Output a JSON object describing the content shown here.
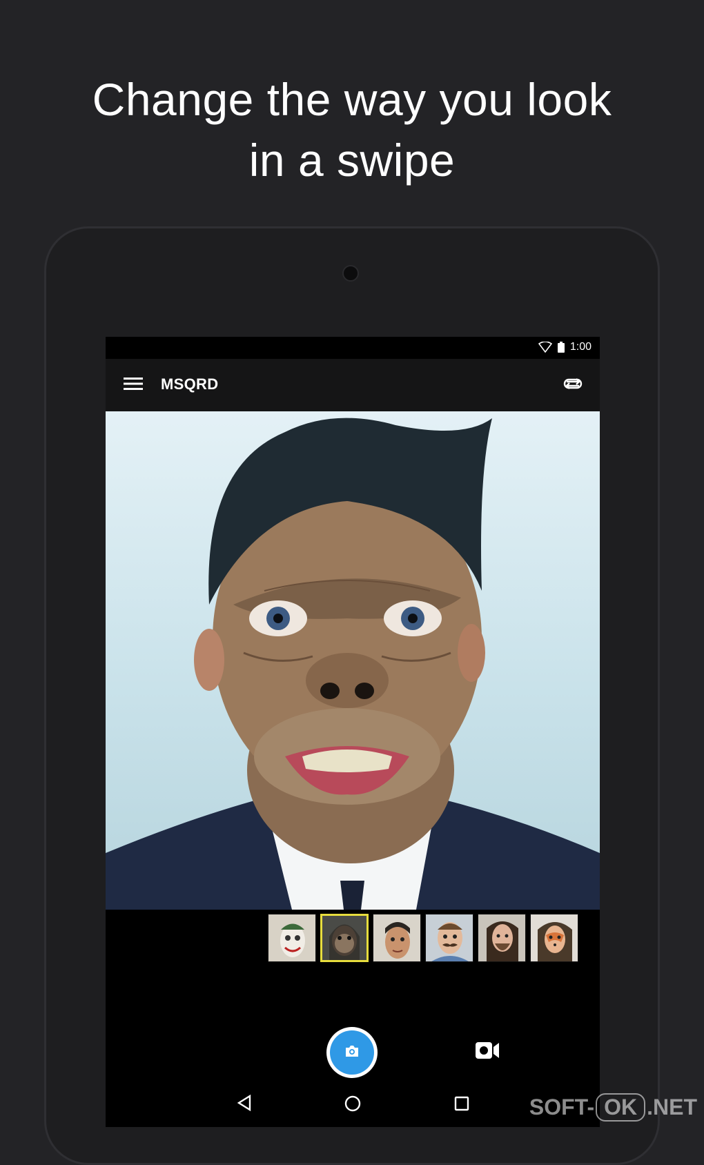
{
  "headline": {
    "line1": "Change the way you look",
    "line2": "in a swipe"
  },
  "status_bar": {
    "time": "1:00",
    "icons": [
      "wifi-icon",
      "battery-icon"
    ]
  },
  "app_bar": {
    "title": "MSQRD",
    "left_icon": "hamburger-menu-icon",
    "right_icon": "switch-camera-icon"
  },
  "preview": {
    "subject": "camera-preview"
  },
  "filters": {
    "selected_index": 1,
    "items": [
      {
        "name": "joker-mask"
      },
      {
        "name": "monkey-mask"
      },
      {
        "name": "face-swap"
      },
      {
        "name": "mustache"
      },
      {
        "name": "beard"
      },
      {
        "name": "fox-mask"
      }
    ]
  },
  "controls": {
    "shutter_icon": "camera-icon",
    "video_icon": "video-camera-icon",
    "accent": "#2f99e6"
  },
  "nav_bar": {
    "icons": [
      "back-icon",
      "home-icon",
      "recent-apps-icon"
    ]
  },
  "watermark": {
    "left": "SOFT-",
    "box": "OK",
    "right": ".NET"
  }
}
